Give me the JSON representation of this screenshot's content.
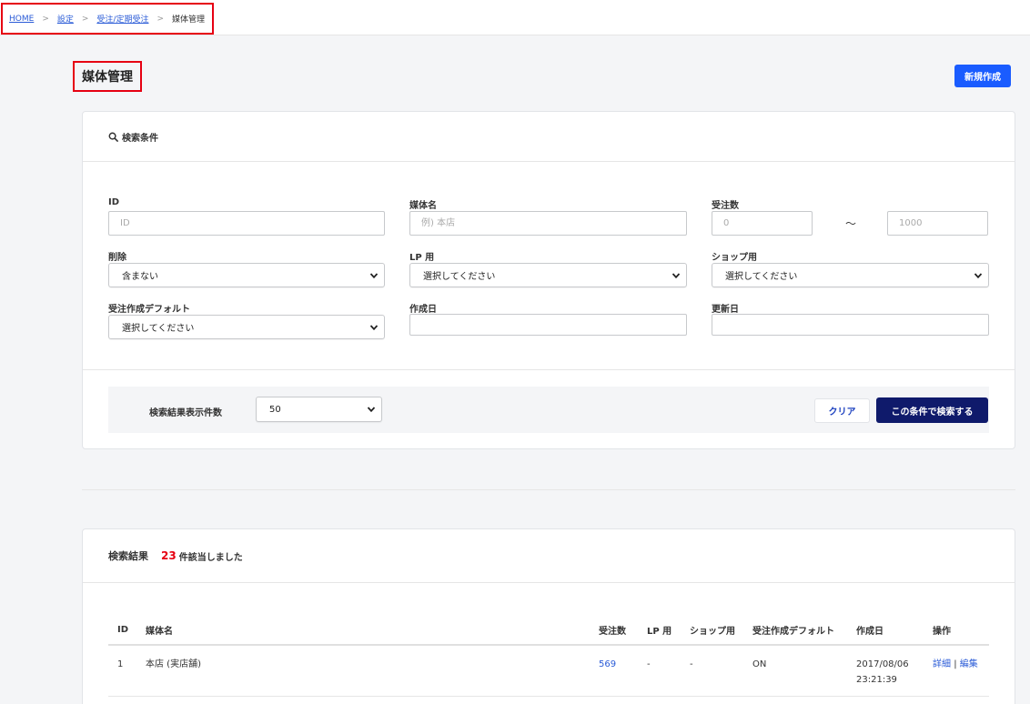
{
  "breadcrumb": {
    "items": [
      "HOME",
      "設定",
      "受注/定期受注"
    ],
    "current": "媒体管理",
    "separator": ">"
  },
  "page": {
    "title": "媒体管理",
    "new_button": "新規作成"
  },
  "search": {
    "heading": "検索条件",
    "fields": {
      "id": {
        "label": "ID",
        "placeholder": "ID"
      },
      "media_name": {
        "label": "媒体名",
        "placeholder": "例) 本店"
      },
      "order_count": {
        "label": "受注数",
        "min_placeholder": "0",
        "max_placeholder": "1000",
        "range_sep": "〜"
      },
      "deleted": {
        "label": "削除",
        "value": "含まない"
      },
      "lp": {
        "label": "LP 用",
        "value": "選択してください"
      },
      "shop": {
        "label": "ショップ用",
        "value": "選択してください"
      },
      "order_default": {
        "label": "受注作成デフォルト",
        "value": "選択してください"
      },
      "created": {
        "label": "作成日",
        "value": ""
      },
      "updated": {
        "label": "更新日",
        "value": ""
      }
    },
    "page_size_label": "検索結果表示件数",
    "page_size_value": "50",
    "clear_button": "クリア",
    "submit_button": "この条件で検索する"
  },
  "results": {
    "heading": "検索結果",
    "count": "23",
    "count_suffix": "件該当しました",
    "columns": [
      "ID",
      "媒体名",
      "受注数",
      "LP 用",
      "ショップ用",
      "受注作成デフォルト",
      "作成日",
      "操作"
    ],
    "rows": [
      {
        "id": "1",
        "name": "本店 (実店舗)",
        "orders": "569",
        "lp": "-",
        "shop": "-",
        "order_default": "ON",
        "created_date": "2017/08/06",
        "created_time": "23:21:39",
        "detail": "詳細",
        "action_sep": "|",
        "edit": "編集"
      }
    ]
  },
  "colors": {
    "accent_blue": "#1a5cff",
    "navy": "#0f1a6b",
    "highlight_red": "#e60012",
    "link": "#2a5bd7"
  }
}
